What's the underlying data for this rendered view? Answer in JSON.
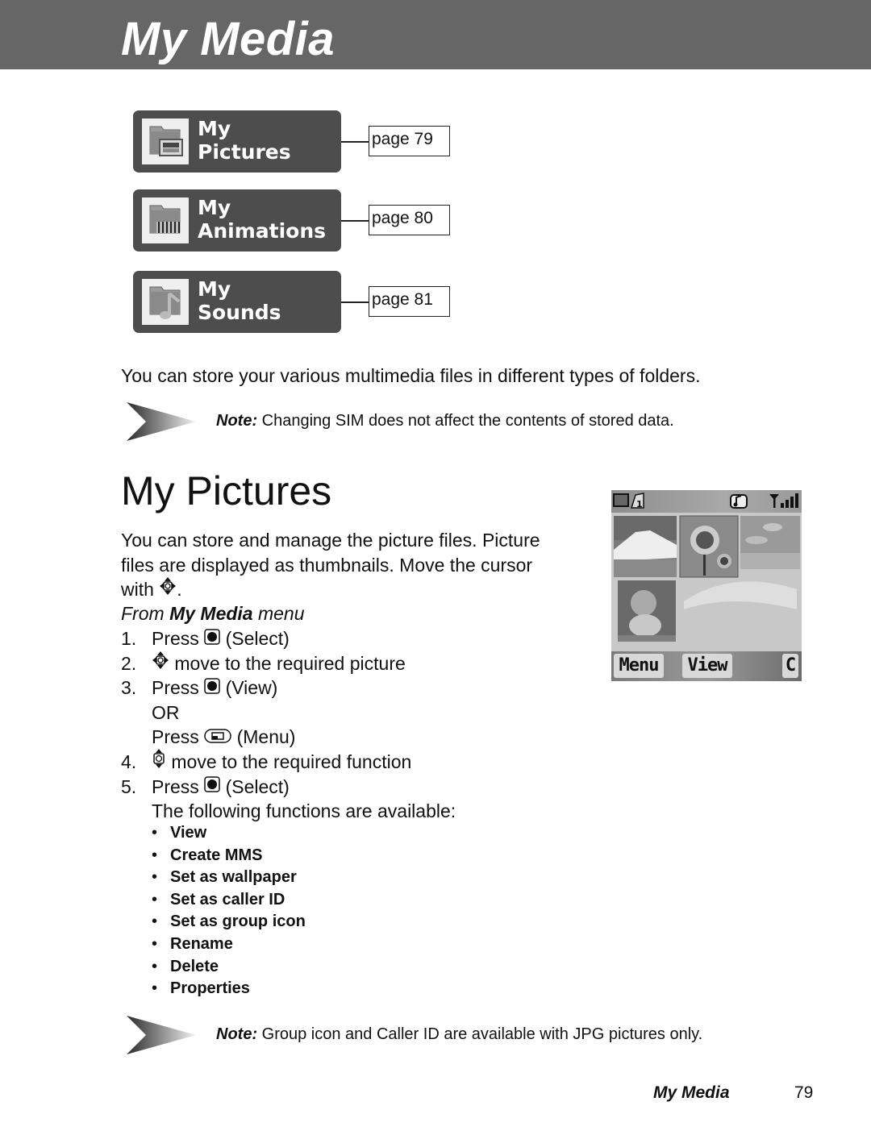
{
  "header": {
    "title": "My Media"
  },
  "folders": [
    {
      "line1": "My",
      "line2": "Pictures",
      "icon": "pictures-folder-icon",
      "page_ref": "page 79"
    },
    {
      "line1": "My",
      "line2": "Animations",
      "icon": "animations-folder-icon",
      "page_ref": "page 80"
    },
    {
      "line1": "My",
      "line2": "Sounds",
      "icon": "sounds-folder-icon",
      "page_ref": "page 81"
    }
  ],
  "intro": "You can store your various multimedia files in different types of folders.",
  "notes": [
    {
      "label": "Note:",
      "text": " Changing SIM does not affect the contents of stored data."
    },
    {
      "label": "Note:",
      "text": " Group icon and Caller ID are available with JPG pictures only."
    }
  ],
  "section": {
    "title": "My Pictures",
    "para_line1": "You can store and manage the picture files. Picture",
    "para_line2": "files are displayed as thumbnails. Move the cursor",
    "para_line3_pre": "with ",
    "para_line3_post": ".",
    "from_pre": "From ",
    "from_bold": "My Media",
    "from_post": " menu"
  },
  "steps": [
    {
      "num": "1.",
      "pre": "Press ",
      "icon": "select-key-icon",
      "post": " (Select)"
    },
    {
      "num": "2.",
      "pre": "",
      "icon": "nav-4way-icon",
      "post": " move to the required picture"
    },
    {
      "num": "3.",
      "pre": "Press ",
      "icon": "select-key-icon",
      "post": " (View)"
    },
    {
      "num": "",
      "pre": "OR",
      "icon": "",
      "post": ""
    },
    {
      "num": "",
      "pre": "Press ",
      "icon": "menu-key-icon",
      "post": " (Menu)"
    },
    {
      "num": "4.",
      "pre": "",
      "icon": "nav-updown-icon",
      "post": " move to the required function"
    },
    {
      "num": "5.",
      "pre": "Press ",
      "icon": "select-key-icon",
      "post": " (Select)"
    },
    {
      "num": "",
      "pre": "The following functions are available:",
      "icon": "",
      "post": ""
    }
  ],
  "functions": [
    "View",
    "Create MMS",
    "Set as wallpaper",
    "Set as caller ID",
    "Set as group icon",
    "Rename",
    "Delete",
    "Properties"
  ],
  "bullet": "•",
  "phone_screen": {
    "status_icons": [
      "battery-icon",
      "message-icon",
      "vibrate-ring-icon",
      "signal-icon"
    ],
    "thumbnails": [
      "mountain-thumbnail",
      "sunflower-thumbnail",
      "sky-thumbnail",
      "dog-thumbnail"
    ],
    "softkeys": {
      "left": "Menu",
      "center": "View",
      "right": "C"
    }
  },
  "footer": {
    "section": "My Media",
    "page": "79"
  }
}
